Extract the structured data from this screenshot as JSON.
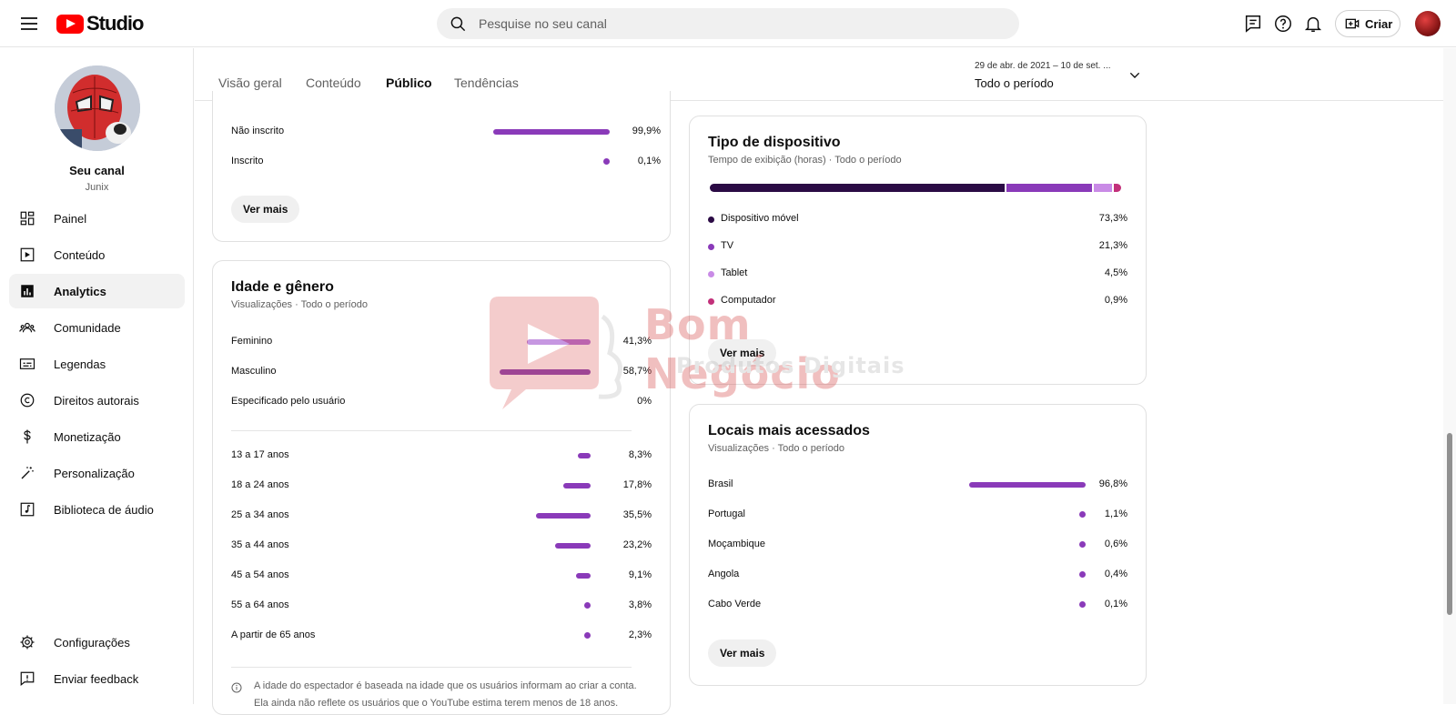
{
  "header": {
    "logo_text": "Studio",
    "search_placeholder": "Pesquise no seu canal",
    "create_label": "Criar"
  },
  "sidebar": {
    "channel_name": "Seu canal",
    "channel_handle": "Junix",
    "items": [
      {
        "label": "Painel",
        "icon": "dashboard-icon"
      },
      {
        "label": "Conteúdo",
        "icon": "content-icon"
      },
      {
        "label": "Analytics",
        "icon": "analytics-icon"
      },
      {
        "label": "Comunidade",
        "icon": "community-icon"
      },
      {
        "label": "Legendas",
        "icon": "subtitles-icon"
      },
      {
        "label": "Direitos autorais",
        "icon": "copyright-icon"
      },
      {
        "label": "Monetização",
        "icon": "dollar-icon"
      },
      {
        "label": "Personalização",
        "icon": "magic-wand-icon"
      },
      {
        "label": "Biblioteca de áudio",
        "icon": "audio-library-icon"
      }
    ],
    "bottom_items": [
      {
        "label": "Configurações",
        "icon": "gear-icon"
      },
      {
        "label": "Enviar feedback",
        "icon": "feedback-icon"
      }
    ]
  },
  "tabs": [
    "Visão geral",
    "Conteúdo",
    "Público",
    "Tendências"
  ],
  "date_range": {
    "sub": "29 de abr. de 2021 – 10 de set. ...",
    "main": "Todo o período"
  },
  "subscription": {
    "rows": [
      {
        "label": "Não inscrito",
        "value": "99,9%",
        "pct": 99.9
      },
      {
        "label": "Inscrito",
        "value": "0,1%",
        "pct": 0.1
      }
    ],
    "see_more": "Ver mais"
  },
  "age_gender": {
    "title": "Idade e gênero",
    "subtitle": "Visualizações · Todo o período",
    "gender": [
      {
        "label": "Feminino",
        "value": "41,3%",
        "pct": 41.3
      },
      {
        "label": "Masculino",
        "value": "58,7%",
        "pct": 58.7
      },
      {
        "label": "Especificado pelo usuário",
        "value": "0%",
        "pct": 0
      }
    ],
    "age": [
      {
        "label": "13 a 17 anos",
        "value": "8,3%",
        "pct": 8.3
      },
      {
        "label": "18 a 24 anos",
        "value": "17,8%",
        "pct": 17.8
      },
      {
        "label": "25 a 34 anos",
        "value": "35,5%",
        "pct": 35.5
      },
      {
        "label": "35 a 44 anos",
        "value": "23,2%",
        "pct": 23.2
      },
      {
        "label": "45 a 54 anos",
        "value": "9,1%",
        "pct": 9.1
      },
      {
        "label": "55 a 64 anos",
        "value": "3,8%",
        "pct": 3.8
      },
      {
        "label": "A partir de 65 anos",
        "value": "2,3%",
        "pct": 2.3
      }
    ],
    "footnote_line1": "A idade do espectador é baseada na idade que os usuários informam ao criar a conta.",
    "footnote_line2": "Ela ainda não reflete os usuários que o YouTube estima terem menos de 18 anos."
  },
  "device": {
    "title": "Tipo de dispositivo",
    "subtitle": "Tempo de exibição (horas) · Todo o período",
    "items": [
      {
        "label": "Dispositivo móvel",
        "value": "73,3%",
        "pct": 73.3,
        "color": "#2b0b45"
      },
      {
        "label": "TV",
        "value": "21,3%",
        "pct": 21.3,
        "color": "#8a3ab9"
      },
      {
        "label": "Tablet",
        "value": "4,5%",
        "pct": 4.5,
        "color": "#c98be6"
      },
      {
        "label": "Computador",
        "value": "0,9%",
        "pct": 0.9,
        "color": "#c2307a"
      }
    ],
    "see_more": "Ver mais"
  },
  "locations": {
    "title": "Locais mais acessados",
    "subtitle": "Visualizações · Todo o período",
    "rows": [
      {
        "label": "Brasil",
        "value": "96,8%",
        "pct": 96.8
      },
      {
        "label": "Portugal",
        "value": "1,1%",
        "pct": 1.1
      },
      {
        "label": "Moçambique",
        "value": "0,6%",
        "pct": 0.6
      },
      {
        "label": "Angola",
        "value": "0,4%",
        "pct": 0.4
      },
      {
        "label": "Cabo Verde",
        "value": "0,1%",
        "pct": 0.1
      }
    ],
    "see_more": "Ver mais"
  },
  "watermark": {
    "line1": "Bom Negócio",
    "line2": "Produtos Digitais"
  },
  "colors": {
    "accent": "#8a3ab9",
    "youtube_red": "#ff0000"
  }
}
